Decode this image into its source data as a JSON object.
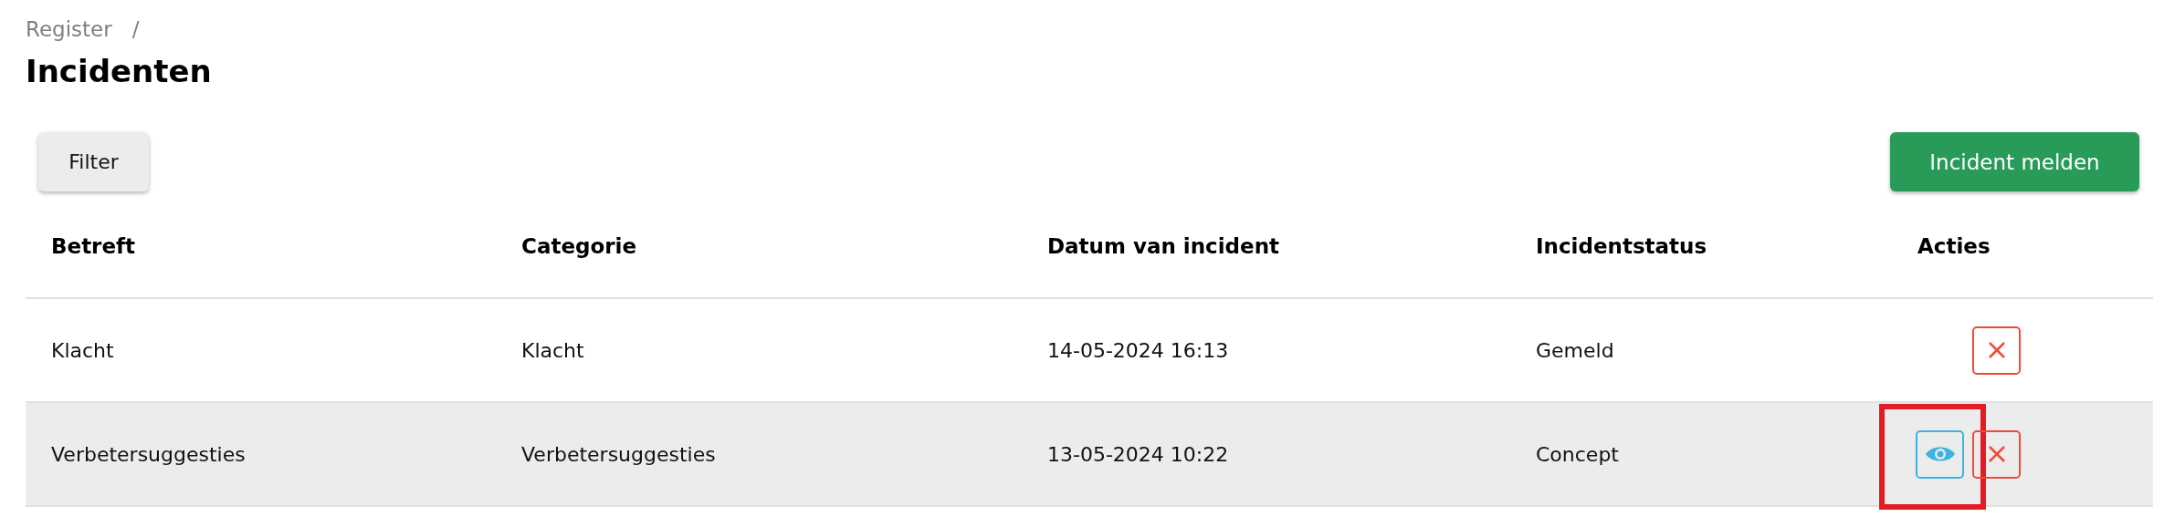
{
  "breadcrumb": {
    "items": [
      "Register"
    ],
    "separator": "/"
  },
  "title": "Incidenten",
  "toolbar": {
    "filter_button": "Filter",
    "report_button": "Incident melden"
  },
  "table": {
    "columns": [
      "Betreft",
      "Categorie",
      "Datum van incident",
      "Incidentstatus",
      "Acties"
    ],
    "rows": [
      {
        "cells": [
          "Klacht",
          "Klacht",
          "14-05-2024 16:13",
          "Gemeld"
        ],
        "shaded": false,
        "actions": [
          {
            "kind": "delete",
            "highlighted": false
          }
        ]
      },
      {
        "cells": [
          "Verbetersuggesties",
          "Verbetersuggesties",
          "13-05-2024 10:22",
          "Concept"
        ],
        "shaded": true,
        "actions": [
          {
            "kind": "view",
            "highlighted": true
          },
          {
            "kind": "delete",
            "highlighted": false
          }
        ]
      }
    ]
  }
}
